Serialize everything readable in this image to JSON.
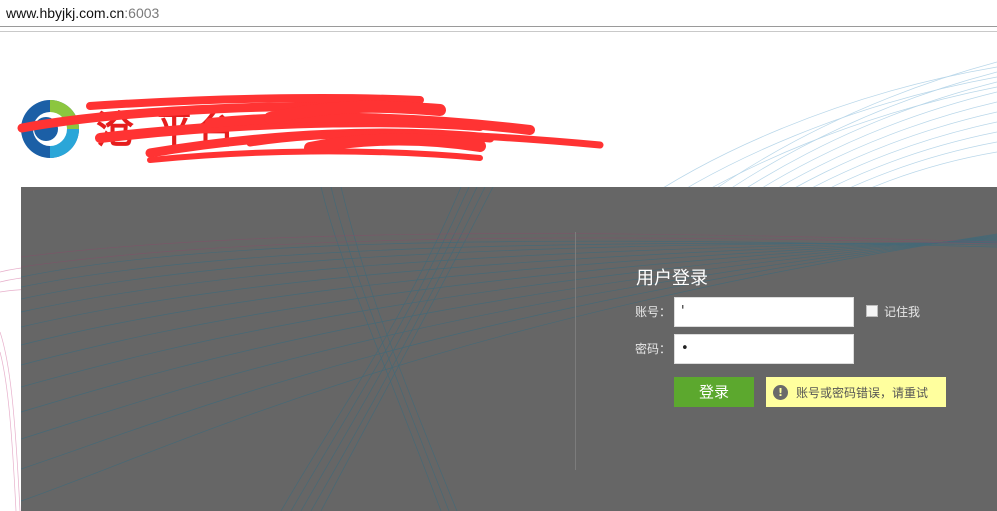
{
  "browser": {
    "url_host": "www.hbyjkj.com.cn",
    "url_port": ":6003"
  },
  "header": {
    "site_title_visible": "沧          平台",
    "logo_icon": "circular-logo-icon"
  },
  "login": {
    "title": "用户登录",
    "account_label": "账号：",
    "account_value": "'",
    "password_label": "密码：",
    "password_value": "•",
    "remember_label": "记住我",
    "remember_checked": false,
    "submit_label": "登录",
    "error_message": "账号或密码错误，请重试",
    "error_icon": "exclamation-circle-icon"
  },
  "colors": {
    "panel_bg": "#666666",
    "button_green": "#5ca82e",
    "error_bg": "#ffff9e",
    "redaction_red": "#ff3333"
  }
}
